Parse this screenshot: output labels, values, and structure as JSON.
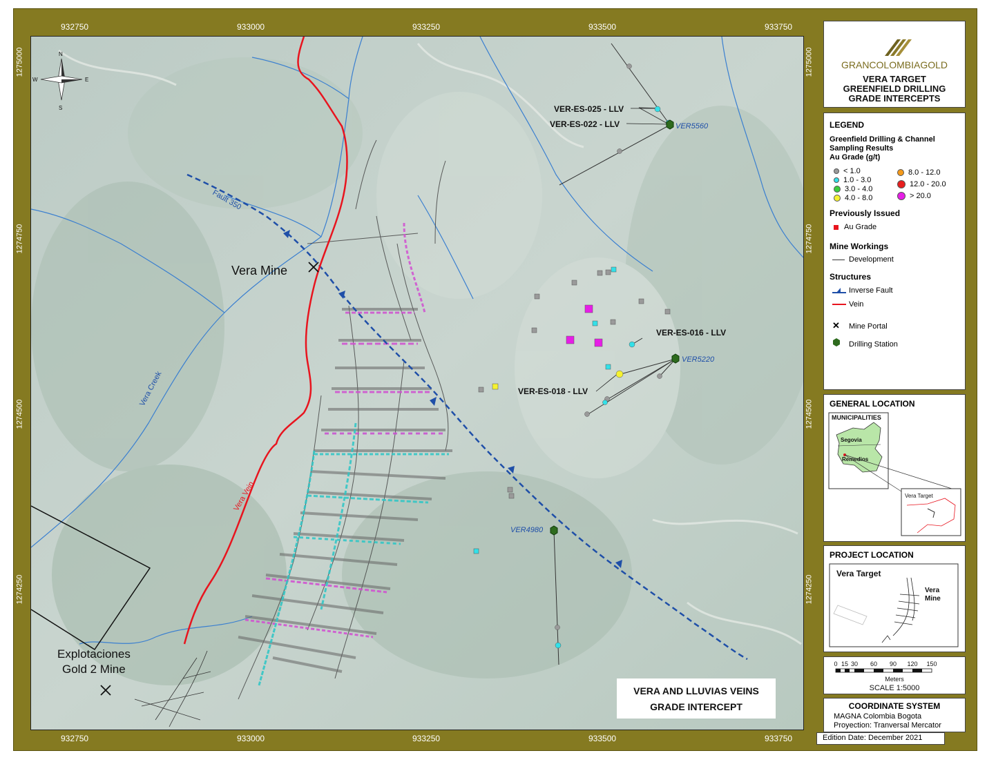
{
  "map": {
    "top_ticks": [
      "932750",
      "933000",
      "933250",
      "933500",
      "933750"
    ],
    "bottom_ticks": [
      "932750",
      "933000",
      "933250",
      "933500",
      "933750"
    ],
    "left_ticks": [
      "1275000",
      "1274750",
      "1274500",
      "1274250"
    ],
    "right_ticks": [
      "1275000",
      "1274750",
      "1274500",
      "1274250"
    ],
    "compass": {
      "n": "N",
      "s": "S",
      "e": "E",
      "w": "W"
    },
    "labels": {
      "vera_mine": "Vera Mine",
      "explotaciones": "Explotaciones",
      "gold2": "Gold 2 Mine",
      "fault": "Fault 350",
      "vera_creek": "Vera Creek",
      "vera_vein": "Vera Vein",
      "ver_es_025": "VER-ES-025 - LLV",
      "ver_es_022": "VER-ES-022 - LLV",
      "ver_es_016": "VER-ES-016 - LLV",
      "ver_es_018": "VER-ES-018 - LLV",
      "ver5560": "VER5560",
      "ver5220": "VER5220",
      "ver4980": "VER4980"
    },
    "intercept_box": {
      "line1": "VERA AND LLUVIAS VEINS",
      "line2": "GRADE INTERCEPT"
    }
  },
  "title_panel": {
    "logo": "GRANCOLOMBIAGOLD",
    "line1": "VERA TARGET",
    "line2": "GREENFIELD DRILLING",
    "line3": "GRADE INTERCEPTS"
  },
  "legend": {
    "title": "LEGEND",
    "section1_l1": "Greenfield Drilling & Channel",
    "section1_l2": "Sampling Results",
    "section1_l3": "Au Grade (g/t)",
    "grades": [
      {
        "label": "< 1.0",
        "color": "#9a9a9a"
      },
      {
        "label": "1.0 - 3.0",
        "color": "#33e0e8"
      },
      {
        "label": "3.0 - 4.0",
        "color": "#3ccc3c"
      },
      {
        "label": "4.0 - 8.0",
        "color": "#f5f230"
      },
      {
        "label": "8.0 - 12.0",
        "color": "#f59a1a"
      },
      {
        "label": "12.0 - 20.0",
        "color": "#e81e1e"
      },
      {
        "label": "> 20.0",
        "color": "#e61ee6"
      }
    ],
    "prev_issued": "Previously Issued",
    "au_grade": "Au Grade",
    "mine_workings": "Mine Workings",
    "development": "Development",
    "structures": "Structures",
    "inverse_fault": "Inverse Fault",
    "vein": "Vein",
    "mine_portal": "Mine Portal",
    "drilling_station": "Drilling Station"
  },
  "general_location": {
    "title": "GENERAL LOCATION",
    "municipalities": "MUNICIPALITIES",
    "segovia": "Segovia",
    "remedios": "Remedios",
    "vera_target": "Vera Target"
  },
  "project_location": {
    "title": "PROJECT LOCATION",
    "vera_target": "Vera Target",
    "vera": "Vera",
    "mine": "Mine"
  },
  "scale": {
    "ticks": [
      "0",
      "15",
      "30",
      "60",
      "90",
      "120",
      "150"
    ],
    "unit": "Meters",
    "label": "SCALE 1:5000"
  },
  "coordinate_system": {
    "title": "COORDINATE SYSTEM",
    "line1": "MAGNA Colombia Bogota",
    "line2": "Proyection: Tranversal Mercator"
  },
  "edition": "Edition Date: December 2021",
  "colors": {
    "frame": "#857a21",
    "fault": "#1f4fa8",
    "vein": "#e8141e",
    "creek": "#3a7fd0",
    "drill_station": "#2e6b1e"
  }
}
